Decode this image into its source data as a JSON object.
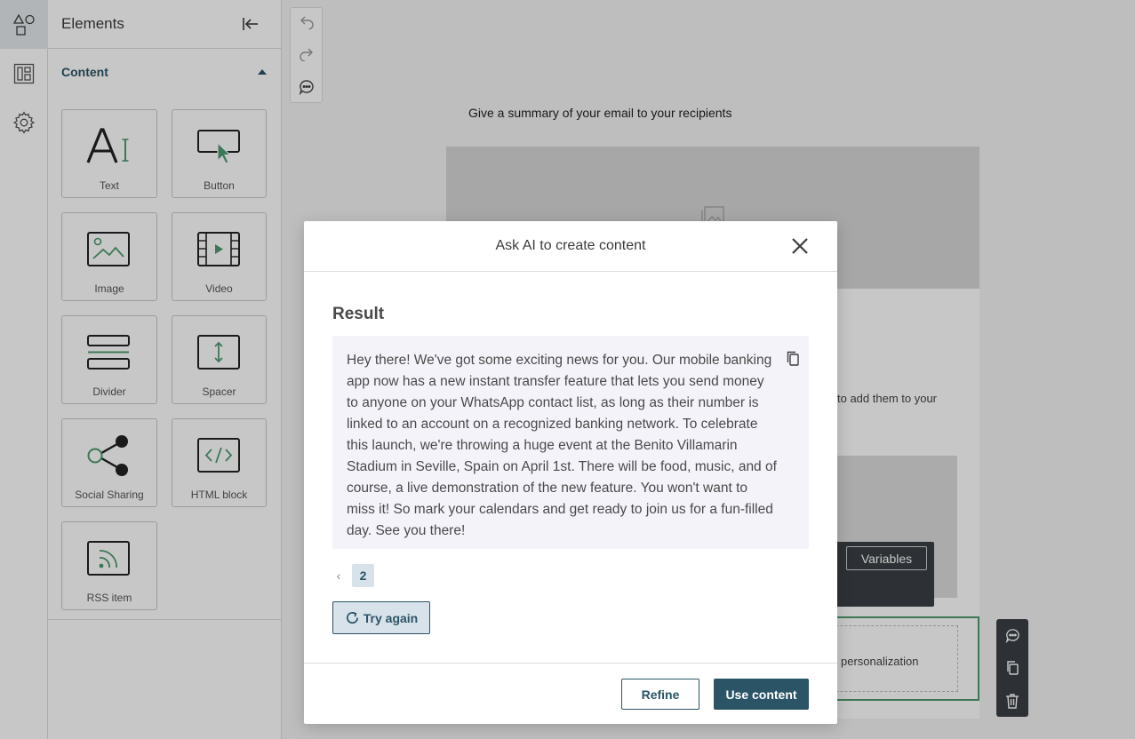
{
  "sidebar": {
    "title": "Elements",
    "section": "Content",
    "tiles": [
      {
        "label": "Text"
      },
      {
        "label": "Button"
      },
      {
        "label": "Image"
      },
      {
        "label": "Video"
      },
      {
        "label": "Divider"
      },
      {
        "label": "Spacer"
      },
      {
        "label": "Social Sharing"
      },
      {
        "label": "HTML block"
      },
      {
        "label": "RSS item"
      }
    ]
  },
  "canvas": {
    "preheader": "Give a summary of your email to your recipients",
    "body_fragment": "to add them to your",
    "variables_label": "Variables",
    "selected_fragment": "personalization"
  },
  "modal": {
    "title": "Ask AI to create content",
    "result_label": "Result",
    "result_text": "Hey there! We've got some exciting news for you. Our mobile banking app now has a new instant transfer feature that lets you send money to anyone on your WhatsApp contact list, as long as their number is linked to an account on a recognized banking network. To celebrate this launch, we're throwing a huge event at the Benito Villamarin Stadium in Seville, Spain on April 1st. There will be food, music, and of course, a live demonstration of the new feature. You won't want to miss it! So mark your calendars and get ready to join us for a fun-filled day. See you there!",
    "page": "2",
    "try_again": "Try again",
    "refine": "Refine",
    "use_content": "Use content"
  },
  "colors": {
    "primary": "#2b5466",
    "accent": "#4e9a6e",
    "result_bg": "#f5f3fa"
  }
}
